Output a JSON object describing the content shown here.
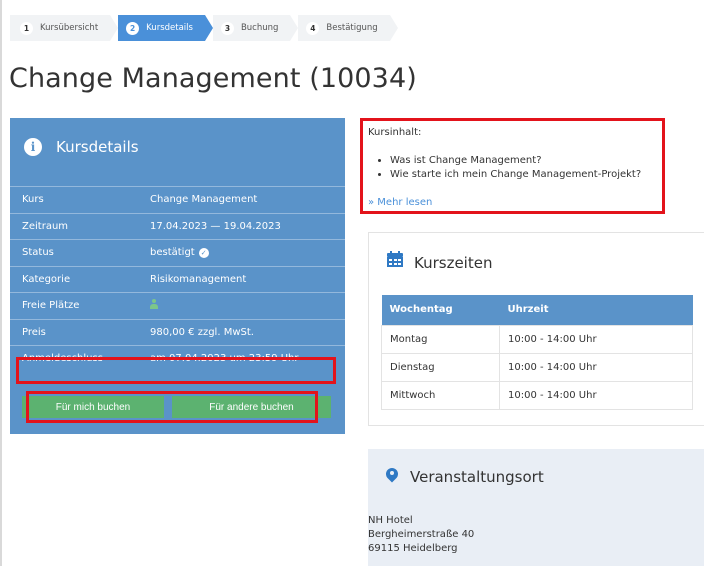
{
  "steps": [
    {
      "num": "1",
      "label": "Kursübersicht"
    },
    {
      "num": "2",
      "label": "Kursdetails"
    },
    {
      "num": "3",
      "label": "Buchung"
    },
    {
      "num": "4",
      "label": "Bestätigung"
    }
  ],
  "page_title": "Change Management (10034)",
  "details": {
    "title": "Kursdetails",
    "rows": [
      {
        "key": "Kurs",
        "value": "Change Management"
      },
      {
        "key": "Zeitraum",
        "value": "17.04.2023 — 19.04.2023"
      },
      {
        "key": "Status",
        "value": "bestätigt"
      },
      {
        "key": "Kategorie",
        "value": "Risikomanagement"
      },
      {
        "key": "Freie Plätze",
        "value": ""
      },
      {
        "key": "Preis",
        "value": "980,00 € zzgl. MwSt."
      },
      {
        "key": "Anmeldeschluss",
        "value": "am 07.04.2023 um 23:59 Uhr"
      }
    ],
    "book_self": "Für mich buchen",
    "book_other": "Für andere buchen"
  },
  "content": {
    "label": "Kursinhalt:",
    "items": [
      "Was ist Change Management?",
      "Wie starte ich mein Change Management-Projekt?"
    ],
    "more": "» Mehr lesen"
  },
  "times": {
    "title": "Kurszeiten",
    "headers": [
      "Wochentag",
      "Uhrzeit"
    ],
    "rows": [
      [
        "Montag",
        "10:00 - 14:00 Uhr"
      ],
      [
        "Dienstag",
        "10:00 - 14:00 Uhr"
      ],
      [
        "Mittwoch",
        "10:00 - 14:00 Uhr"
      ]
    ]
  },
  "location": {
    "title": "Veranstaltungsort",
    "lines": [
      "NH Hotel",
      "Bergheimerstraße 40",
      "69115 Heidelberg"
    ]
  },
  "colors": {
    "accent": "#4a90d9",
    "panel": "#5a93c9",
    "button": "#5cb270",
    "highlight": "#e3131b"
  }
}
